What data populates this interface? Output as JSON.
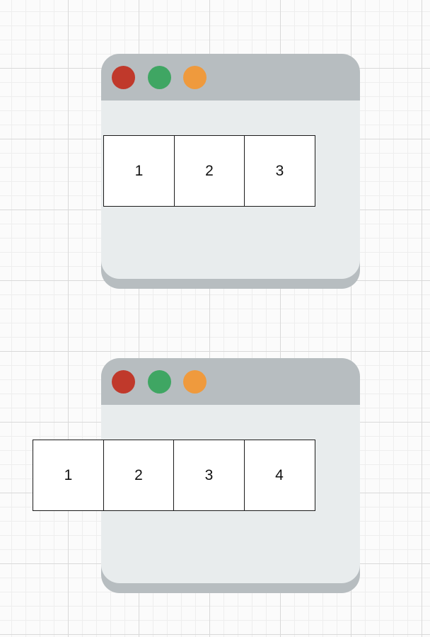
{
  "colors": {
    "dot_red": "#c0392b",
    "dot_green": "#3fa663",
    "dot_orange": "#ef9a3d"
  },
  "windows": [
    {
      "cells": [
        "1",
        "2",
        "3"
      ]
    },
    {
      "cells": [
        "1",
        "2",
        "3",
        "4"
      ]
    }
  ]
}
